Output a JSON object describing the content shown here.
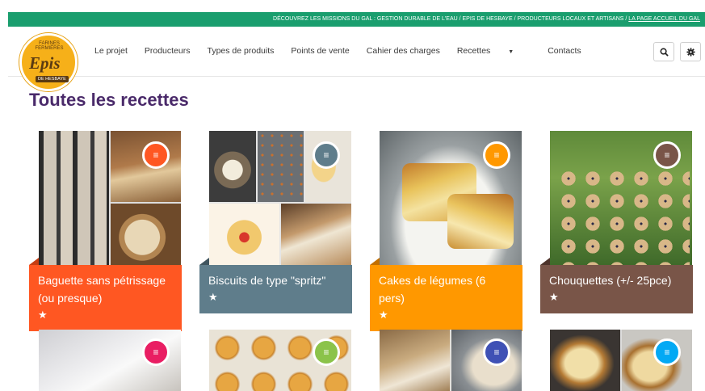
{
  "topbar": {
    "text": "DÉCOUVREZ LES MISSIONS DU GAL : GESTION DURABLE DE L'EAU / EPIS DE HESBAYE / PRODUCTEURS LOCAUX ET ARTISANS / ",
    "link": "LA PAGE ACCUEIL DU GAL"
  },
  "logo": {
    "ring_text": "FARINES FERMIÈRES",
    "main_text": "Epis",
    "sub_text": "DE HESBAYE"
  },
  "nav": {
    "items": [
      "Le projet",
      "Producteurs",
      "Types de produits",
      "Points de vente",
      "Cahier des charges",
      "Recettes",
      "Contacts"
    ],
    "active_index": 5,
    "search_icon": "search-icon",
    "settings_icon": "gear-icon"
  },
  "page": {
    "title": "Toutes les recettes"
  },
  "recipes": [
    {
      "title": "Baguette sans pétrissage (ou presque)",
      "color": "#ff5722",
      "has_star": true
    },
    {
      "title": "Biscuits de type \"spritz\"",
      "color": "#5f7d8b",
      "has_star": true
    },
    {
      "title": "Cakes de légumes (6 pers)",
      "color": "#ff9800",
      "has_star": true
    },
    {
      "title": "Chouquettes (+/- 25pce)",
      "color": "#795548",
      "has_star": true
    },
    {
      "title": "",
      "color": "#e91e63",
      "has_star": false
    },
    {
      "title": "",
      "color": "#8bc34a",
      "has_star": false
    },
    {
      "title": "",
      "color": "#3f51b5",
      "has_star": false
    },
    {
      "title": "",
      "color": "#03a9f4",
      "has_star": false
    }
  ],
  "icons": {
    "card_badge": "list-icon",
    "rating": "star-icon"
  }
}
